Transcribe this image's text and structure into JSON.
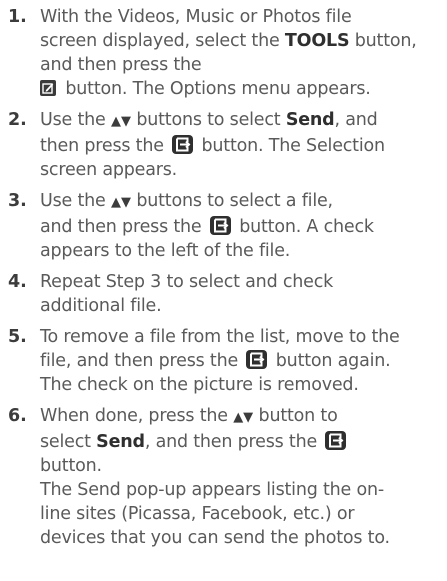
{
  "steps": [
    {
      "num": "1.",
      "l1": "With the Videos, Music or Photos file",
      "l2a": "screen displayed, select the ",
      "l2b": "TOOLS",
      "l2c": " button,",
      "l3": "and then press the",
      "l4": " button. The Options menu appears."
    },
    {
      "num": "2.",
      "l1a": "Use the ",
      "arrows": "▲▼",
      "l1b": " buttons to select ",
      "l1c": "Send",
      "l1d": ", and",
      "l2a": "then press the ",
      "l2b": " button. The Selection",
      "l3": "screen appears."
    },
    {
      "num": "3.",
      "l1a": "Use the ",
      "arrows": "▲▼",
      "l1b": " buttons to select a file,",
      "l2a": "and then press the ",
      "l2b": " button. A check",
      "l3": "appears to the left of the file."
    },
    {
      "num": "4.",
      "l1": "Repeat Step 3 to select and check",
      "l2": "additional file."
    },
    {
      "num": "5.",
      "l1": "To remove a file from the list, move to the",
      "l2a": "file, and then press the ",
      "l2b": " button again.",
      "l3": "The check on the picture is removed."
    },
    {
      "num": "6.",
      "l1a": "When done, press the ",
      "arrows": "▲▼",
      "l1b": " button to",
      "l2a": "select ",
      "l2b": "Send",
      "l2c": ", and then press the ",
      "l3": "button.",
      "l4": "The Send pop-up appears listing the on-",
      "l5": "line sites (Picassa, Facebook, etc.) or",
      "l6": "devices that you can send the photos to."
    }
  ]
}
